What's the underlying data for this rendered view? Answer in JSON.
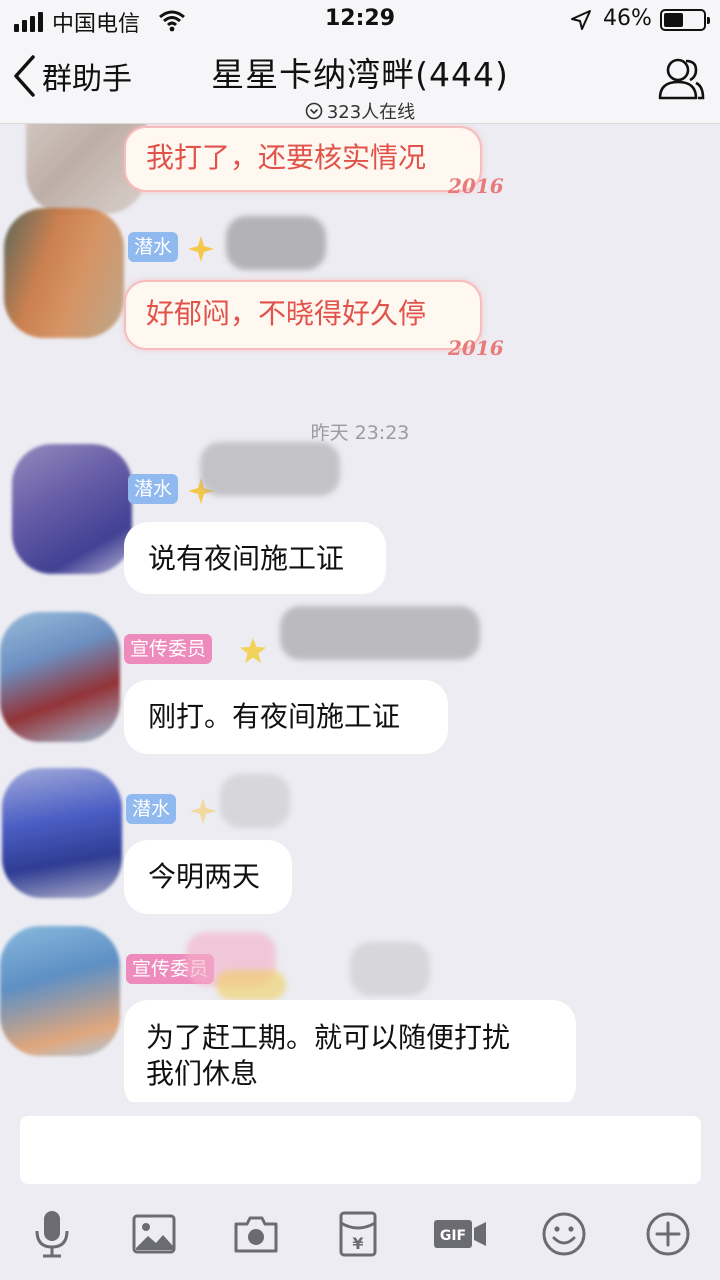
{
  "status_bar": {
    "carrier": "中国电信",
    "time": "12:29",
    "battery": "46%",
    "battery_level": 0.46,
    "icons": [
      "signal-icon",
      "wifi-icon",
      "location-arrow-icon",
      "battery-icon"
    ]
  },
  "nav": {
    "back_label": "群助手",
    "title": "星星卡纳湾畔(444)",
    "online": "323人在线",
    "icons": [
      "back-chevron-icon",
      "online-circle-icon",
      "group-members-icon"
    ]
  },
  "messages": [
    {
      "tag": "",
      "text": "我打了，还要核实情况",
      "themed": true,
      "deco": "2016"
    },
    {
      "tag": "潜水",
      "text": "好郁闷，不晓得好久停",
      "themed": true,
      "deco": "2016"
    },
    {
      "timestamp": "昨天 23:23"
    },
    {
      "tag": "潜水",
      "text": "说有夜间施工证"
    },
    {
      "tag": "宣传委员",
      "text": "刚打。有夜间施工证"
    },
    {
      "tag": "潜水",
      "text": "今明两天"
    },
    {
      "tag": "宣传委员",
      "text_line1": "为了赶工期。就可以随便打扰",
      "text_line2": "我们休息"
    }
  ],
  "toolbar": {
    "icons": [
      "microphone-icon",
      "image-icon",
      "camera-icon",
      "red-packet-icon",
      "gif-icon",
      "emoji-icon",
      "plus-icon"
    ]
  },
  "colors": {
    "background": "#ececf2",
    "bubble": "#ffffff",
    "themed_text": "#e0524a",
    "tag_blue": "#8fb9ef",
    "tag_pink": "#ee8bbd",
    "icon_gray": "#6b6b72"
  }
}
